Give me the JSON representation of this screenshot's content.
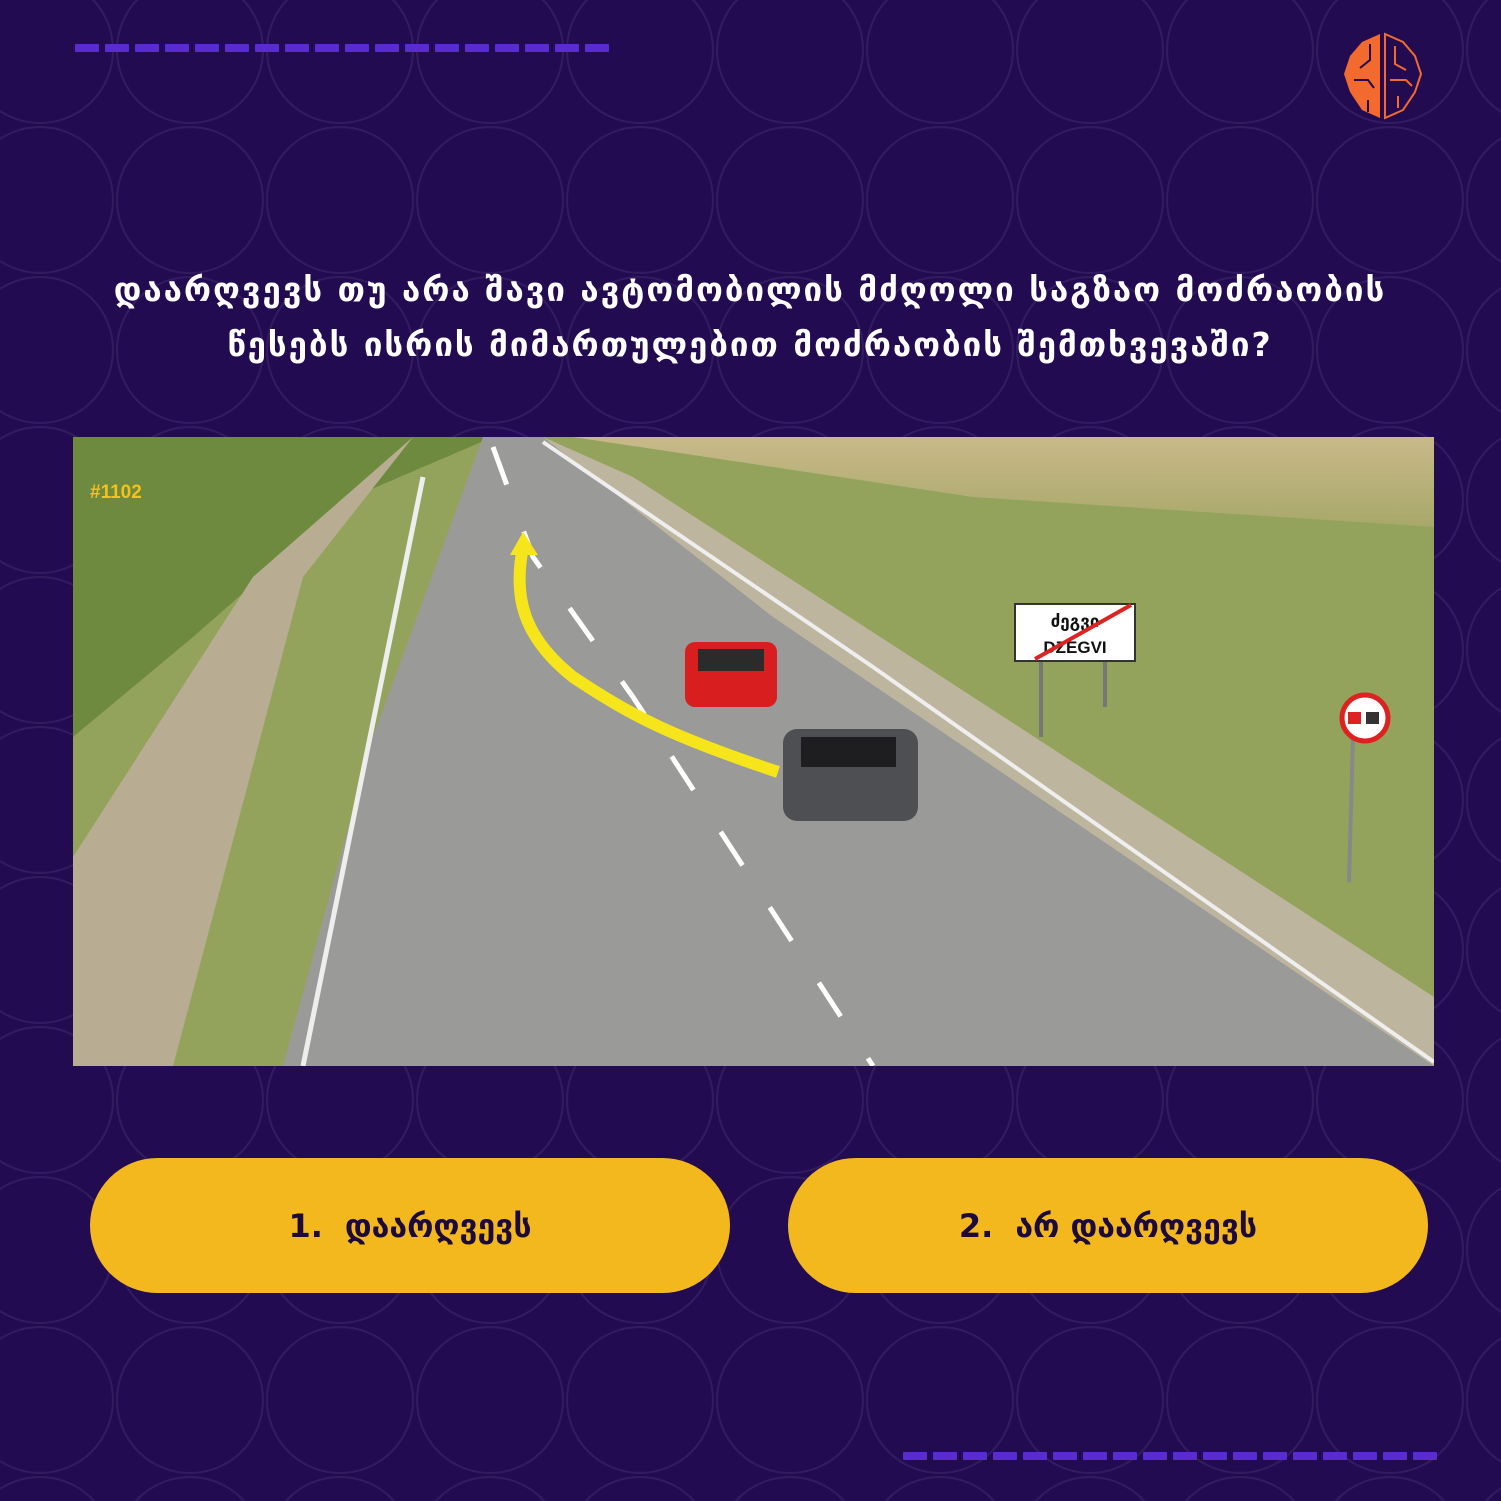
{
  "question": {
    "text": "დაარღვევს თუ არა შავი ავტომობილის მძღოლი საგზაო მოძრაობის წესებს ისრის მიმართულებით მოძრაობის შემთხვევაში?",
    "id": "#1102"
  },
  "image": {
    "sign_top": "ძეგვი",
    "sign_bottom": "DZEGVI"
  },
  "answers": [
    {
      "number": "1.",
      "label": "დაარღვევს"
    },
    {
      "number": "2.",
      "label": "არ დაარღვევს"
    }
  ],
  "colors": {
    "background": "#230b52",
    "accent": "#f2b81e",
    "dash": "#5a2bd0",
    "logo": "#f26a2e",
    "arrow": "#f5e51a"
  },
  "icons": [
    "brain-circuit-logo"
  ]
}
